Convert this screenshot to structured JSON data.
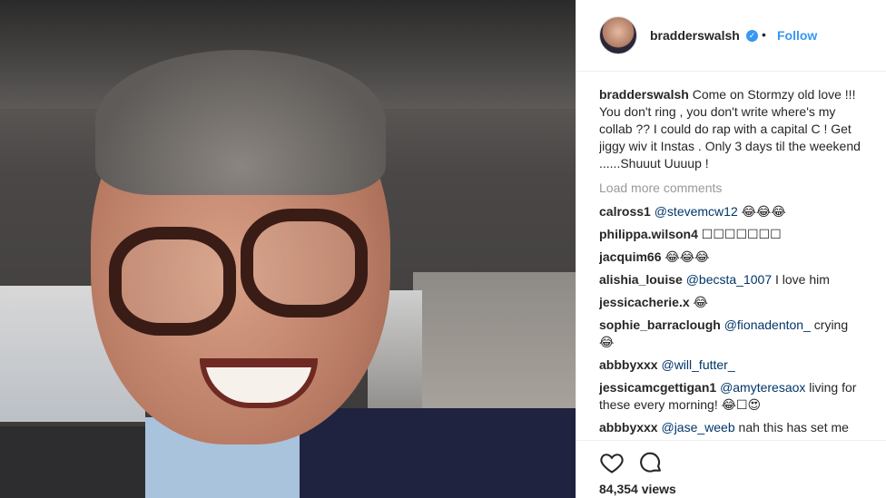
{
  "post": {
    "username": "bradderswalsh",
    "dot": "•",
    "follow_label": "Follow",
    "caption": "Come on Stormzy old love !!! You don't ring , you don't write where's my collab ?? I could do rap with a capital C ! Get jiggy wiv it Instas . Only 3 days til the weekend ......Shuuut Uuuup !",
    "load_more": "Load more comments",
    "views": "84,354 views"
  },
  "comments": [
    {
      "user": "calross1",
      "mention": "@stevemcw12",
      "text": " 😂😂😂"
    },
    {
      "user": "philippa.wilson4",
      "mention": "",
      "text": "☐☐☐☐☐☐☐"
    },
    {
      "user": "jacquim66",
      "mention": "",
      "text": "😂😂😂"
    },
    {
      "user": "alishia_louise",
      "mention": "@becsta_1007",
      "text": " I love him"
    },
    {
      "user": "jessicacherie.x",
      "mention": "",
      "text": "😂"
    },
    {
      "user": "sophie_barraclough",
      "mention": "@fionadenton_",
      "text": " crying 😂"
    },
    {
      "user": "abbbyxxx",
      "mention": "@will_futter_",
      "text": ""
    },
    {
      "user": "jessicamcgettigan1",
      "mention": "@amyteresaox",
      "text": " living for these every morning! 😂☐😍"
    },
    {
      "user": "abbbyxxx",
      "mention": "@jase_weeb",
      "text": " nah this has set me"
    }
  ],
  "icons": {
    "verified": "verified-badge-icon",
    "like": "heart-icon",
    "comment": "comment-bubble-icon"
  },
  "colors": {
    "link": "#3897f0",
    "mention": "#003569",
    "muted": "#999999"
  }
}
